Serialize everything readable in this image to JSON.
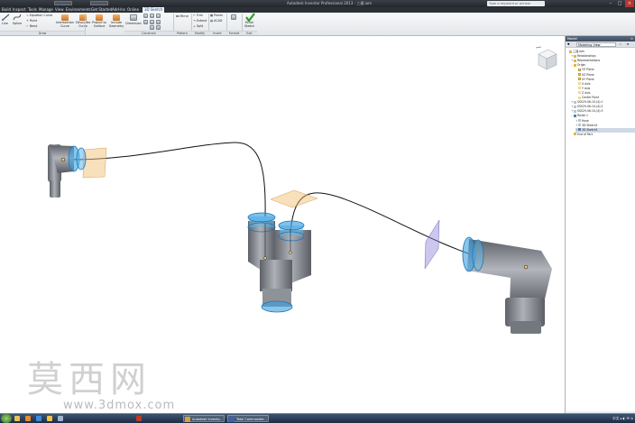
{
  "titlebar": {
    "title": "Autodesk Inventor Professional 2013 · 三通.iam",
    "search_placeholder": "Type a keyword or phrase"
  },
  "menu": {
    "tabs": [
      "Build",
      "Inspect",
      "Tools",
      "Manage",
      "View",
      "Environments",
      "Get Started",
      "Add-Ins",
      "Online",
      "3D Sketch"
    ],
    "active": "3D Sketch"
  },
  "ribbon": {
    "draw": {
      "buttons": [
        {
          "label": "Line",
          "icon": "line-icon"
        },
        {
          "label": "Spline",
          "icon": "spline-icon"
        },
        {
          "label": "Equation Curve",
          "icon": "equation-curve-icon"
        },
        {
          "label": "Point",
          "icon": "point-icon"
        },
        {
          "label": "Bend",
          "icon": "bend-icon"
        },
        {
          "label": "Intersection Curve",
          "icon": "intersection-curve-icon"
        },
        {
          "label": "Silhouette Curve",
          "icon": "silhouette-curve-icon"
        },
        {
          "label": "Project to Surface",
          "icon": "project-to-surface-icon"
        },
        {
          "label": "Include Geometry",
          "icon": "include-geometry-icon"
        },
        {
          "label": "Dimension",
          "icon": "dimension-icon"
        }
      ],
      "group_label": "Draw"
    },
    "constrain": {
      "group_label": "Constrain"
    },
    "pattern": {
      "label": "Mirror",
      "group_label": "Pattern"
    },
    "modify": {
      "buttons": [
        "Trim",
        "Extend",
        "Split"
      ],
      "group_label": "Modify"
    },
    "insert": {
      "buttons": [
        "Points",
        "ACAD"
      ],
      "group_label": "Insert"
    },
    "format": {
      "group_label": "Format"
    },
    "exit": {
      "label": "Finish Sketch",
      "group_label": "Exit"
    }
  },
  "browser": {
    "title": "Model",
    "view": "Modeling View",
    "items": [
      {
        "label": "三通.iam",
        "level": 0,
        "icon": "folder",
        "expander": ""
      },
      {
        "label": "Relationships",
        "level": 1,
        "icon": "folder",
        "expander": "+"
      },
      {
        "label": "Representations",
        "level": 1,
        "icon": "folder",
        "expander": "+"
      },
      {
        "label": "Origin",
        "level": 1,
        "icon": "folder",
        "expander": "-"
      },
      {
        "label": "YZ Plane",
        "level": 2,
        "icon": "plane",
        "expander": ""
      },
      {
        "label": "XZ Plane",
        "level": 2,
        "icon": "plane",
        "expander": ""
      },
      {
        "label": "XY Plane",
        "level": 2,
        "icon": "plane",
        "expander": ""
      },
      {
        "label": "X Axis",
        "level": 2,
        "icon": "axis",
        "expander": ""
      },
      {
        "label": "Y Axis",
        "level": 2,
        "icon": "axis",
        "expander": ""
      },
      {
        "label": "Z Axis",
        "level": 2,
        "icon": "axis",
        "expander": ""
      },
      {
        "label": "Center Point",
        "level": 2,
        "icon": "axis",
        "expander": ""
      },
      {
        "label": "SSS29-06-10-(4):1",
        "level": 1,
        "icon": "part",
        "expander": "+"
      },
      {
        "label": "SSS29-06-10-(4):2",
        "level": 1,
        "icon": "part",
        "expander": "+"
      },
      {
        "label": "SSS29-06-10-(4):3",
        "level": 1,
        "icon": "part",
        "expander": "+"
      },
      {
        "label": "Route 1",
        "level": 1,
        "icon": "sel",
        "expander": "-"
      },
      {
        "label": "Hose",
        "level": 2,
        "icon": "part",
        "expander": "+"
      },
      {
        "label": "3D Sketch1",
        "level": 2,
        "icon": "part",
        "expander": "+"
      },
      {
        "label": "3D Sketch1",
        "level": 2,
        "icon": "sel",
        "expander": "+"
      },
      {
        "label": "End of Part",
        "level": 1,
        "icon": "folder",
        "expander": ""
      }
    ],
    "highlight_index": 17
  },
  "watermark": {
    "cn": "莫西网",
    "url": "www.3dmox.com"
  },
  "taskbar": {
    "items": [
      {
        "label": "",
        "icon": "explorer-icon"
      },
      {
        "label": "",
        "icon": "media-icon"
      },
      {
        "label": "",
        "icon": "ie-icon"
      },
      {
        "label": "",
        "icon": "folder-icon"
      },
      {
        "label": "",
        "icon": "app-icon"
      },
      {
        "label": "",
        "icon": "app-icon"
      },
      {
        "label": "Autodesk Invento...",
        "icon": "inventor-icon"
      },
      {
        "label": "Total Commander...",
        "icon": "total-commander-icon"
      }
    ],
    "tray_text": "中文 ▴ ◐ ✉ ◷"
  },
  "colors": {
    "accent": "#1c4d8a",
    "fitting_blue": "#3aa0e0",
    "plane_orange": "#f2c27a",
    "plane_purple": "#8f86d6"
  }
}
